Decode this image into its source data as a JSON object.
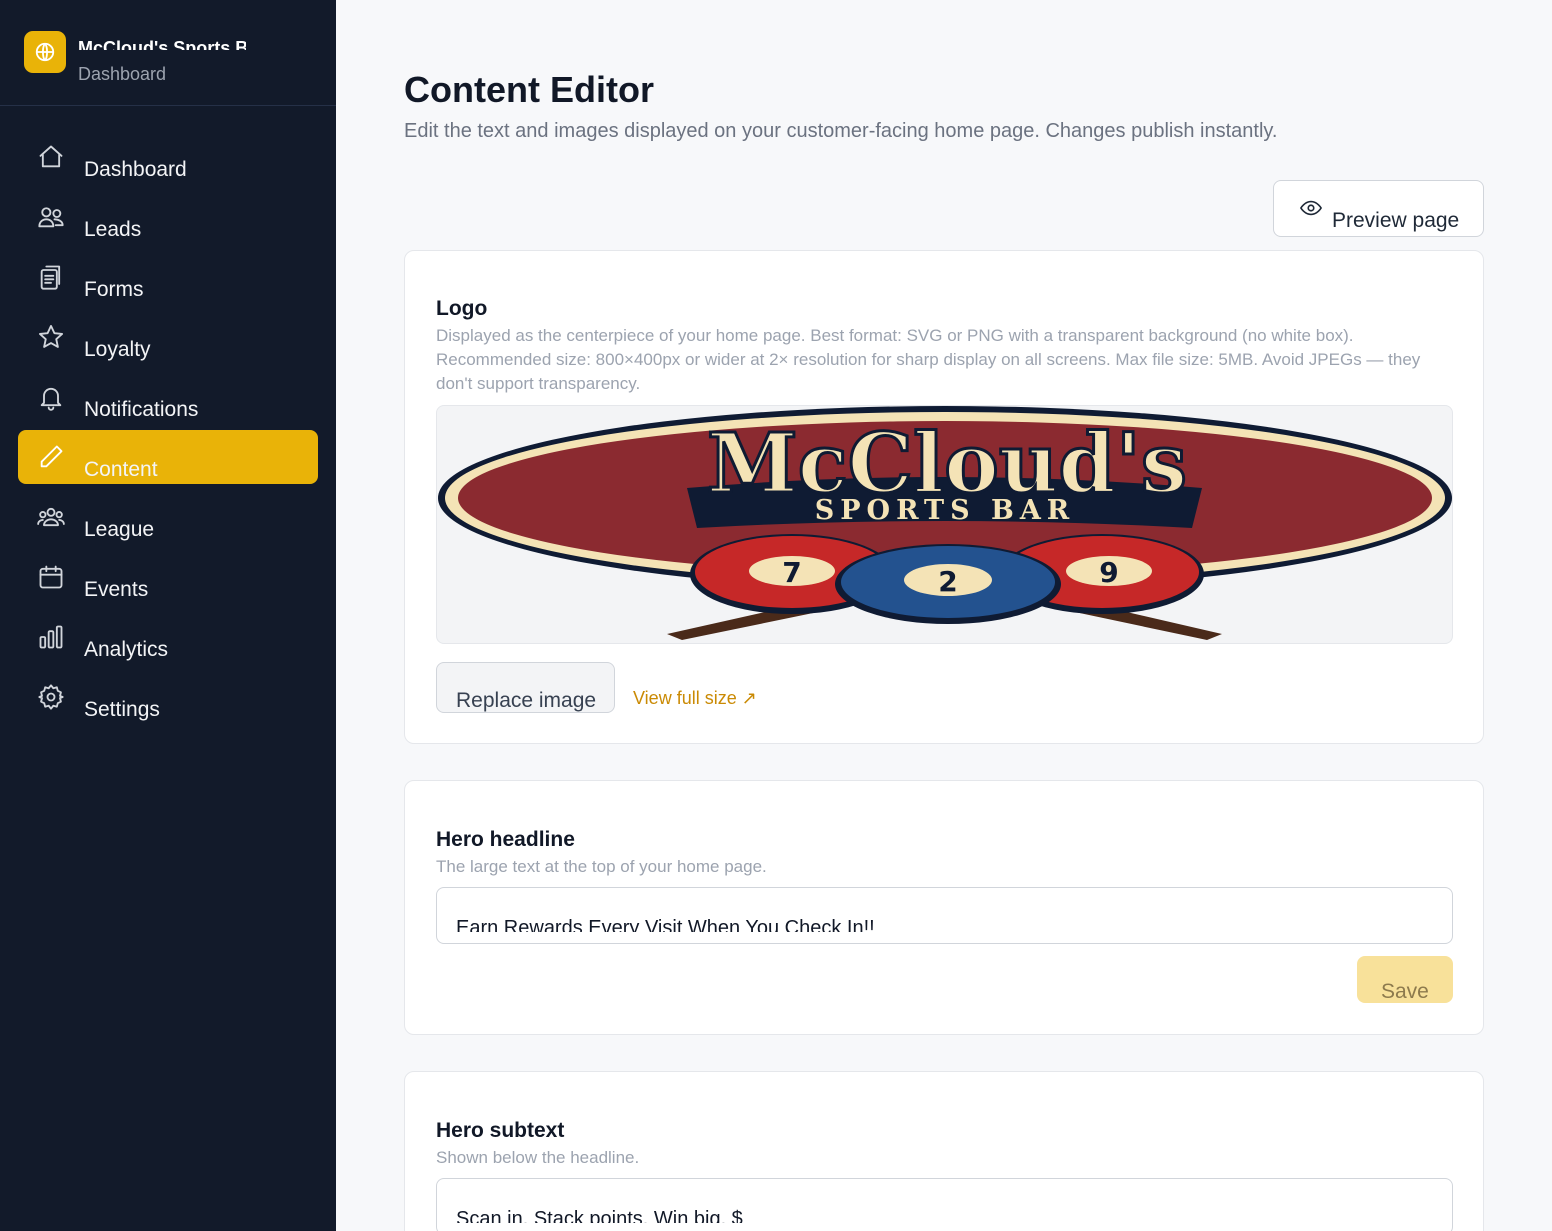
{
  "brand": {
    "name": "McCloud's Sports Bar",
    "subtitle": "Dashboard",
    "icon": "globe-icon"
  },
  "sidebar": {
    "items": [
      {
        "label": "Dashboard",
        "icon": "home-icon",
        "active": false
      },
      {
        "label": "Leads",
        "icon": "users-icon",
        "active": false
      },
      {
        "label": "Forms",
        "icon": "clipboard-icon",
        "active": false
      },
      {
        "label": "Loyalty",
        "icon": "star-icon",
        "active": false
      },
      {
        "label": "Notifications",
        "icon": "bell-icon",
        "active": false
      },
      {
        "label": "Content",
        "icon": "pencil-icon",
        "active": true
      },
      {
        "label": "League",
        "icon": "group-icon",
        "active": false
      },
      {
        "label": "Events",
        "icon": "calendar-icon",
        "active": false
      },
      {
        "label": "Analytics",
        "icon": "bar-chart-icon",
        "active": false
      },
      {
        "label": "Settings",
        "icon": "gear-icon",
        "active": false
      }
    ]
  },
  "header": {
    "title": "Content Editor",
    "description": "Edit the text and images displayed on your customer-facing home page. Changes publish instantly.",
    "preview_label": "Preview page"
  },
  "logo_card": {
    "title": "Logo",
    "help": "Displayed as the centerpiece of your home page. Best format: SVG or PNG with a transparent background (no white box). Recommended size: 800×400px or wider at 2× resolution for sharp display on all screens. Max file size: 5MB. Avoid JPEGs — they don't support transparency.",
    "logo_text_main": "McCloud's",
    "logo_text_sub": "SPORTS BAR",
    "balls": [
      "7",
      "2",
      "9"
    ],
    "replace_label": "Replace image",
    "view_label": "View full size ↗"
  },
  "headline_card": {
    "title": "Hero headline",
    "help": "The large text at the top of your home page.",
    "value": "Earn Rewards Every Visit When You Check In!!",
    "save_label": "Save"
  },
  "subtext_card": {
    "title": "Hero subtext",
    "help": "Shown below the headline.",
    "value": "Scan in. Stack points. Win big. $"
  },
  "colors": {
    "accent": "#e9b308",
    "sidebar": "#121a2a",
    "link": "#ca8a04"
  }
}
